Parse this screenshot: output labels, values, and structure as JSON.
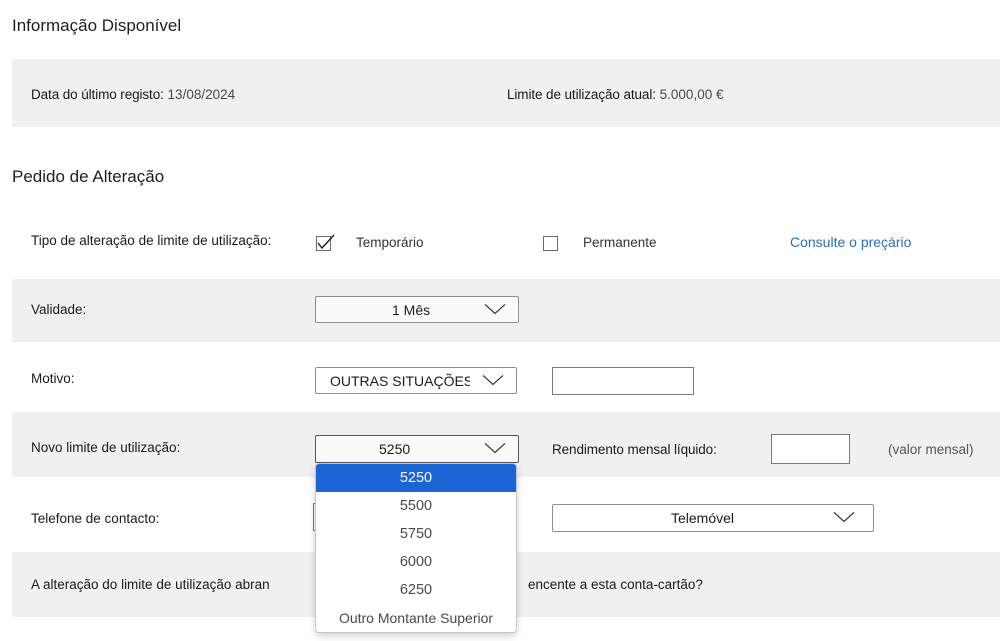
{
  "info": {
    "title": "Informação Disponível",
    "last_record_label": "Data do último registo:",
    "last_record_value": "13/08/2024",
    "limit_label": "Limite de utilização atual:",
    "limit_value": "5.000,00 €"
  },
  "request": {
    "title": "Pedido de Alteração",
    "type_label": "Tipo de alteração de limite de utilização:",
    "temporary_label": "Temporário",
    "temporary_checked": true,
    "permanent_label": "Permanente",
    "permanent_checked": false,
    "pricing_link": "Consulte o preçário",
    "validity_label": "Validade:",
    "validity_value": "1 Mês",
    "reason_label": "Motivo:",
    "reason_value": "OUTRAS SITUAÇÕES",
    "reason_text_value": "",
    "new_limit_label": "Novo limite de utilização:",
    "new_limit_value": "5250",
    "new_limit_options": [
      "5250",
      "5500",
      "5750",
      "6000",
      "6250",
      "Outro Montante Superior"
    ],
    "income_label": "Rendimento mensal líquido:",
    "income_value": "",
    "income_suffix": "(valor mensal)",
    "phone_label": "Telefone de contacto:",
    "phone_type_value": "Telemóvel",
    "question_start": "A alteração do limite de utilização abran",
    "question_end": "encente a esta conta-cartão?"
  },
  "colors": {
    "band": "#f0f0f0",
    "link": "#2a6fb8",
    "option_selected": "#1a64d6"
  }
}
